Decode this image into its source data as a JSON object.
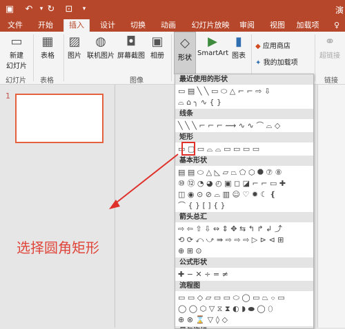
{
  "window": {
    "title_fragment": "演"
  },
  "tabs": [
    "文件",
    "开始",
    "插入",
    "设计",
    "切换",
    "动画",
    "幻灯片放映",
    "审阅",
    "视图",
    "加载项",
    "♀"
  ],
  "active_tab": "插入",
  "ribbon": {
    "new_slide": "新建\n幻灯片",
    "table": "表格",
    "picture": "图片",
    "online_picture": "联机图片",
    "screenshot": "屏幕截图",
    "album": "相册",
    "shapes": "形状",
    "smartart": "SmartArt",
    "chart": "图表",
    "store": "应用商店",
    "my_addins": "我的加载项",
    "hyperlink": "超链接",
    "groups": {
      "slides": "幻灯片",
      "tables": "表格",
      "images": "图像",
      "links": "链接"
    }
  },
  "slide_panel": {
    "number": "1"
  },
  "annotation": "选择圆角矩形",
  "gallery": {
    "sections": [
      "最近使用的形状",
      "线条",
      "矩形",
      "基本形状",
      "箭头总汇",
      "公式形状",
      "流程图"
    ],
    "rows": {
      "recent1": "▭ ▤ ╲ ╲ ▭ ⬭ △ ⌐ ⌐ ⇨ ⇩",
      "recent2": "⌓ ⌂ ╮ ∿ { }",
      "lines": "╲ ╲ ╲ ⌐ ⌐ ⌐ ⟿ ∿ ∿ ⌒ ⌓ ◇",
      "rects": "▭ ▢ ▭ ⌓ ⌓ ▭ ▭ ▭ ▭",
      "basic1": "▤ ▤ ⬭ △ ◺ ▱ ⏢ ⬠ ⬡ ⯃ ⑦ ⑧",
      "basic2": "⑩ ⑫ ◔ ◕ ◴ ▣ ◻ ◪ ⌐ ⌐ ▭ ✚",
      "basic3": "◫ ◉ ⊙ ⊘ ⌓ ▥ ☺ ♡ ✹ ☾ ❴",
      "basic4": "⌒ { } [ ] { }",
      "arrows1": "⇨ ⇦ ⇧ ⇩ ⇔ ⇕ ✥ ⇆ ↰ ↱ ↲ ⤴",
      "arrows2": "⟲ ⟳ ⤺ ⤻ ⇛ ⇨ ⇨ ⇨ ▷ ⊳ ⊲ ⊞",
      "arrows3": "⊕ ⊞ ⊙",
      "formula": "✚ − ✕ ÷ = ≠",
      "flow1": "▭ ▭ ◇ ▱ ▭ ▭ ⬭ ◯ ▭ ⏢ ⌔ ▭",
      "flow2": "◯ ◯ ⬡ ▽ ⧖ ⧗ ◐ ◗ ⬬ ◯ ⬯",
      "flow3": "⊕ ⊗ ⌛ ▽ ◊ ◇"
    },
    "bottom_partial": "星与旗帜"
  },
  "colors": {
    "accent": "#b7472a",
    "annotation": "#e0453a"
  }
}
